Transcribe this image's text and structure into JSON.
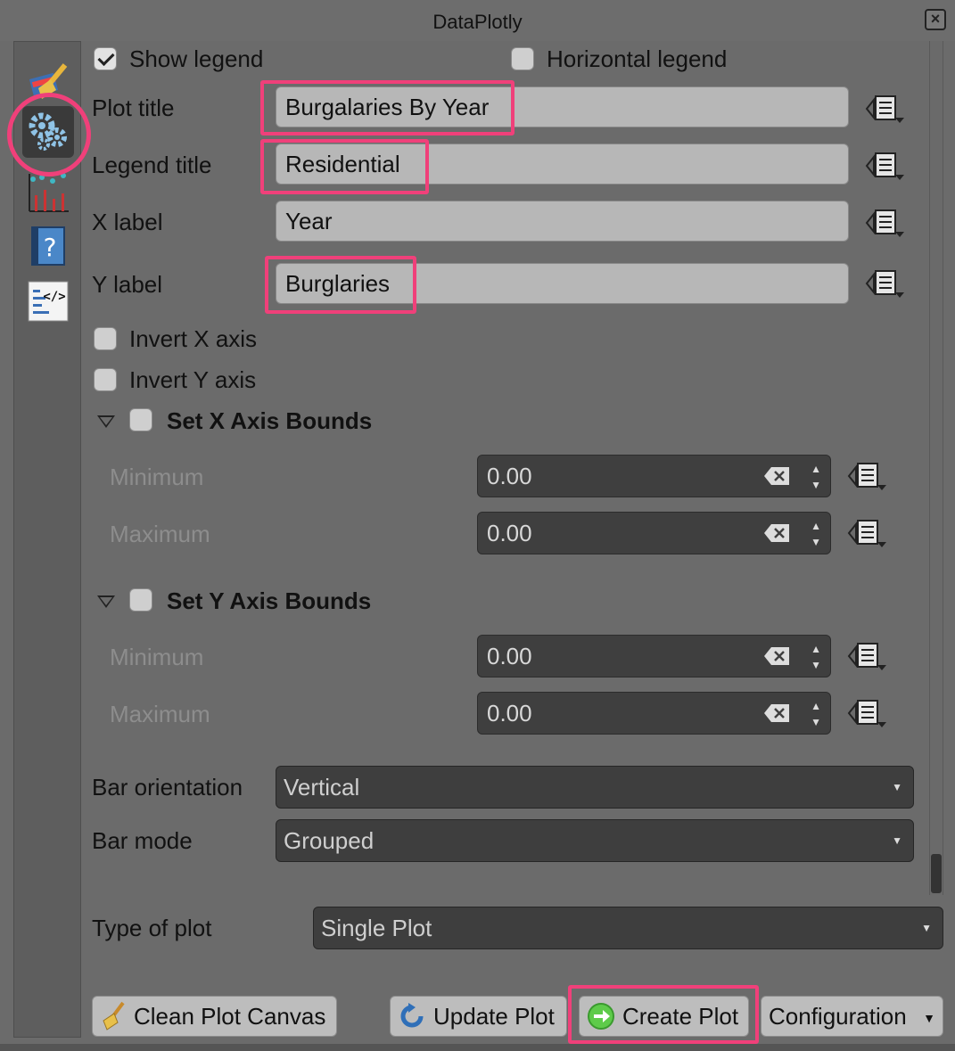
{
  "window": {
    "title": "DataPlotly"
  },
  "sidebar": {
    "items": [
      {
        "icon": "broom-paint-icon"
      },
      {
        "icon": "gears-icon"
      },
      {
        "icon": "scatter-bar-chart-icon"
      },
      {
        "icon": "help-book-icon"
      },
      {
        "icon": "code-page-icon"
      }
    ]
  },
  "legend": {
    "show_legend_label": "Show legend",
    "show_legend_checked": true,
    "horizontal_legend_label": "Horizontal legend",
    "horizontal_legend_checked": false
  },
  "fields": {
    "plot_title_label": "Plot title",
    "plot_title_value": "Burgalaries By Year",
    "legend_title_label": "Legend title",
    "legend_title_value": "Residential",
    "x_label_label": "X label",
    "x_label_value": "Year",
    "y_label_label": "Y label",
    "y_label_value": "Burglaries"
  },
  "axes": {
    "invert_x_label": "Invert X axis",
    "invert_y_label": "Invert Y axis",
    "x_bounds_label": "Set X Axis Bounds",
    "y_bounds_label": "Set Y Axis Bounds",
    "minimum_label": "Minimum",
    "maximum_label": "Maximum",
    "x_min_value": "0.00",
    "x_max_value": "0.00",
    "y_min_value": "0.00",
    "y_max_value": "0.00"
  },
  "bar": {
    "orientation_label": "Bar orientation",
    "orientation_value": "Vertical",
    "mode_label": "Bar mode",
    "mode_value": "Grouped"
  },
  "plot_type": {
    "label": "Type of plot",
    "value": "Single Plot"
  },
  "buttons": {
    "clean_label": "Clean Plot Canvas",
    "update_label": "Update Plot",
    "create_label": "Create Plot",
    "configuration_label": "Configuration"
  },
  "colors": {
    "highlight": "#f0407a",
    "panel": "#6b6b6b"
  }
}
